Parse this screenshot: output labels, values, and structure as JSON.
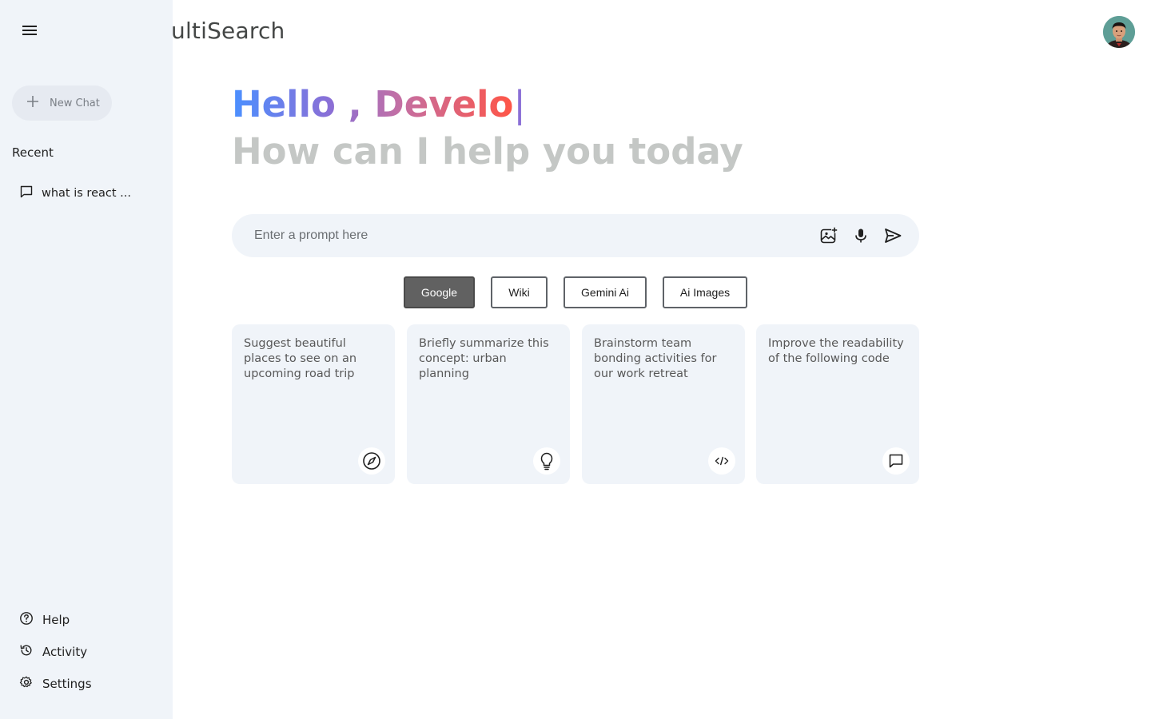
{
  "app": {
    "title": "ultiSearch"
  },
  "sidebar": {
    "new_chat_label": "New Chat",
    "recent_title": "Recent",
    "recent_items": [
      {
        "label": "what is react ..."
      }
    ],
    "bottom_items": [
      {
        "label": "Help",
        "icon": "question-circle-icon"
      },
      {
        "label": "Activity",
        "icon": "history-icon"
      },
      {
        "label": "Settings",
        "icon": "gear-icon"
      }
    ]
  },
  "greeting": {
    "hello": "Hello , Develo",
    "cursor": "|",
    "subtitle": "How can I help you today"
  },
  "prompt": {
    "placeholder": "Enter a prompt here",
    "value": ""
  },
  "engines": [
    {
      "label": "Google",
      "active": true
    },
    {
      "label": "Wiki",
      "active": false
    },
    {
      "label": "Gemini Ai",
      "active": false
    },
    {
      "label": "Ai Images",
      "active": false
    }
  ],
  "cards": [
    {
      "text": "Suggest beautiful places to see on an upcoming road trip",
      "icon": "compass-icon"
    },
    {
      "text": "Briefly summarize this concept: urban planning",
      "icon": "lightbulb-icon"
    },
    {
      "text": "Brainstorm team bonding activities for our work retreat",
      "icon": "code-icon"
    },
    {
      "text": "Improve the readability of the following code",
      "icon": "message-icon"
    }
  ],
  "colors": {
    "sidebar_bg": "#f0f4f9",
    "active_engine": "#616161",
    "gradient_start": "#4b90ff",
    "gradient_end": "#ff5546",
    "subtitle": "#c4c7c5"
  }
}
